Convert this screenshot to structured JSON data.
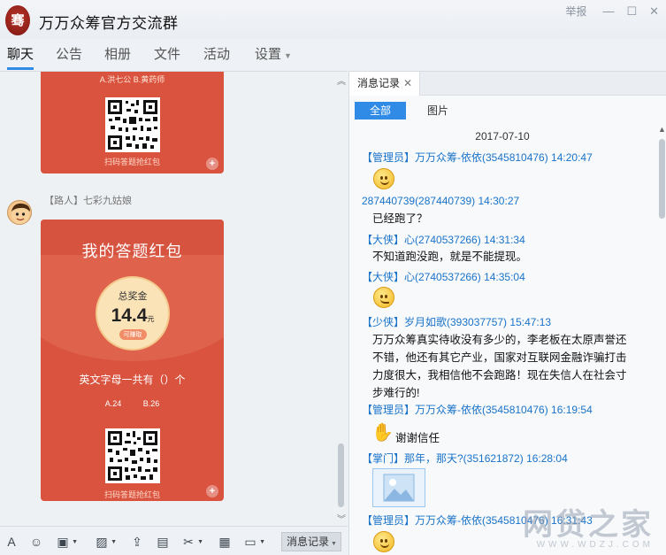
{
  "window": {
    "title": "万万众筹官方交流群",
    "avatar_glyph": "骞",
    "report_label": "举报",
    "minimize_glyph": "—",
    "maximize_glyph": "☐",
    "close_glyph": "✕"
  },
  "tabs": [
    {
      "label": "聊天",
      "active": true
    },
    {
      "label": "公告"
    },
    {
      "label": "相册"
    },
    {
      "label": "文件"
    },
    {
      "label": "活动"
    },
    {
      "label": "设置"
    }
  ],
  "chat": {
    "packet1": {
      "options": "A.洪七公  B.黄药师",
      "caption": "扫码答题抢红包"
    },
    "sender": {
      "name": "【路人】七彩九姑娘"
    },
    "packet2": {
      "title": "我的答题红包",
      "prize_label": "总奖金",
      "amount": "14.4",
      "unit": "元",
      "badge": "可赚取",
      "question": "英文字母一共有（）个",
      "answers": "A.24 B.26",
      "caption": "扫码答题抢红包"
    }
  },
  "toolbar": {
    "history_label": "消息记录"
  },
  "history": {
    "tab_label": "消息记录",
    "filter_all": "全部",
    "filter_images": "图片",
    "date": "2017-07-10",
    "entries": [
      {
        "meta": "【管理员】万万众筹-依依(3545810476) 14:20:47"
      },
      {
        "meta": "287440739(287440739) 14:30:27",
        "text": "已经跑了？"
      },
      {
        "meta": "【大侠】心(2740537266) 14:31:34",
        "text": "不知道跑没跑，就是不能提现。"
      },
      {
        "meta": "【大侠】心(2740537266) 14:35:04"
      },
      {
        "meta": "【少侠】岁月如歌(393037757) 15:47:13",
        "lines": [
          "万万众筹真实待收没有多少的，李老板在太原声誉还",
          "不错，他还有其它产业，国家对互联网金融诈骗打击",
          "力度很大，我相信他不会跑路！现在失信人在社会寸",
          "步难行的!"
        ]
      },
      {
        "meta": "【管理员】万万众筹-依依(3545810476) 16:19:54",
        "text": "谢谢信任"
      },
      {
        "meta": "【掌门】那年，那天?(351621872) 16:28:04"
      },
      {
        "meta": "【管理员】万万众筹-依依(3545810476) 16:31:43"
      }
    ]
  },
  "watermark": {
    "main": "网贷之家",
    "sub": "WWW.WDZJ.COM"
  }
}
